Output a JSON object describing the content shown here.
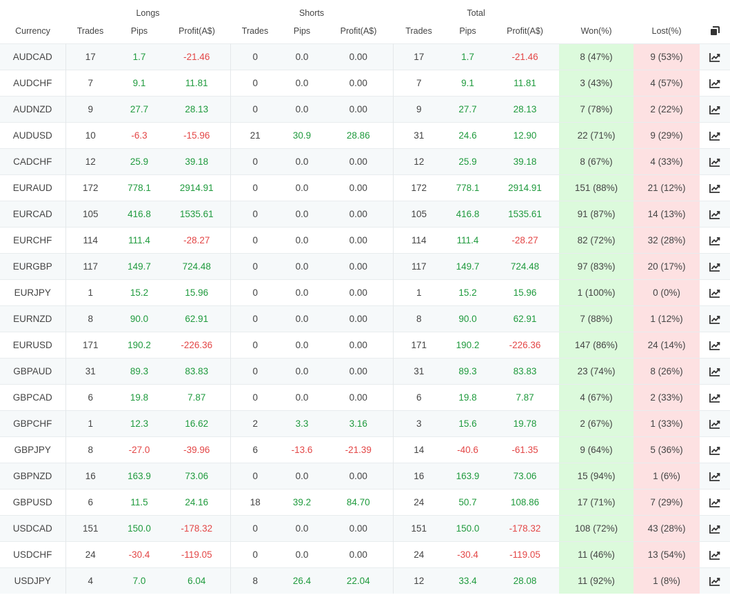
{
  "headers": {
    "longs": "Longs",
    "shorts": "Shorts",
    "total": "Total",
    "currency": "Currency",
    "trades": "Trades",
    "pips": "Pips",
    "profit": "Profit(A$)",
    "won": "Won(%)",
    "lost": "Lost(%)"
  },
  "icons": {
    "copy": "copy-icon",
    "chart": "line-chart-icon"
  },
  "colors": {
    "positive": "#1f9a3d",
    "negative": "#e34646",
    "won_bg": "#dcfadc",
    "lost_bg": "#fde1e2"
  },
  "rows": [
    {
      "currency": "AUDCAD",
      "l_trades": "17",
      "l_pips": "1.7",
      "l_profit": "-21.46",
      "s_trades": "0",
      "s_pips": "0.0",
      "s_profit": "0.00",
      "t_trades": "17",
      "t_pips": "1.7",
      "t_profit": "-21.46",
      "won": "8 (47%)",
      "lost": "9 (53%)"
    },
    {
      "currency": "AUDCHF",
      "l_trades": "7",
      "l_pips": "9.1",
      "l_profit": "11.81",
      "s_trades": "0",
      "s_pips": "0.0",
      "s_profit": "0.00",
      "t_trades": "7",
      "t_pips": "9.1",
      "t_profit": "11.81",
      "won": "3 (43%)",
      "lost": "4 (57%)"
    },
    {
      "currency": "AUDNZD",
      "l_trades": "9",
      "l_pips": "27.7",
      "l_profit": "28.13",
      "s_trades": "0",
      "s_pips": "0.0",
      "s_profit": "0.00",
      "t_trades": "9",
      "t_pips": "27.7",
      "t_profit": "28.13",
      "won": "7 (78%)",
      "lost": "2 (22%)"
    },
    {
      "currency": "AUDUSD",
      "l_trades": "10",
      "l_pips": "-6.3",
      "l_profit": "-15.96",
      "s_trades": "21",
      "s_pips": "30.9",
      "s_profit": "28.86",
      "t_trades": "31",
      "t_pips": "24.6",
      "t_profit": "12.90",
      "won": "22 (71%)",
      "lost": "9 (29%)"
    },
    {
      "currency": "CADCHF",
      "l_trades": "12",
      "l_pips": "25.9",
      "l_profit": "39.18",
      "s_trades": "0",
      "s_pips": "0.0",
      "s_profit": "0.00",
      "t_trades": "12",
      "t_pips": "25.9",
      "t_profit": "39.18",
      "won": "8 (67%)",
      "lost": "4 (33%)"
    },
    {
      "currency": "EURAUD",
      "l_trades": "172",
      "l_pips": "778.1",
      "l_profit": "2914.91",
      "s_trades": "0",
      "s_pips": "0.0",
      "s_profit": "0.00",
      "t_trades": "172",
      "t_pips": "778.1",
      "t_profit": "2914.91",
      "won": "151 (88%)",
      "lost": "21 (12%)"
    },
    {
      "currency": "EURCAD",
      "l_trades": "105",
      "l_pips": "416.8",
      "l_profit": "1535.61",
      "s_trades": "0",
      "s_pips": "0.0",
      "s_profit": "0.00",
      "t_trades": "105",
      "t_pips": "416.8",
      "t_profit": "1535.61",
      "won": "91 (87%)",
      "lost": "14 (13%)"
    },
    {
      "currency": "EURCHF",
      "l_trades": "114",
      "l_pips": "111.4",
      "l_profit": "-28.27",
      "s_trades": "0",
      "s_pips": "0.0",
      "s_profit": "0.00",
      "t_trades": "114",
      "t_pips": "111.4",
      "t_profit": "-28.27",
      "won": "82 (72%)",
      "lost": "32 (28%)"
    },
    {
      "currency": "EURGBP",
      "l_trades": "117",
      "l_pips": "149.7",
      "l_profit": "724.48",
      "s_trades": "0",
      "s_pips": "0.0",
      "s_profit": "0.00",
      "t_trades": "117",
      "t_pips": "149.7",
      "t_profit": "724.48",
      "won": "97 (83%)",
      "lost": "20 (17%)"
    },
    {
      "currency": "EURJPY",
      "l_trades": "1",
      "l_pips": "15.2",
      "l_profit": "15.96",
      "s_trades": "0",
      "s_pips": "0.0",
      "s_profit": "0.00",
      "t_trades": "1",
      "t_pips": "15.2",
      "t_profit": "15.96",
      "won": "1 (100%)",
      "lost": "0 (0%)"
    },
    {
      "currency": "EURNZD",
      "l_trades": "8",
      "l_pips": "90.0",
      "l_profit": "62.91",
      "s_trades": "0",
      "s_pips": "0.0",
      "s_profit": "0.00",
      "t_trades": "8",
      "t_pips": "90.0",
      "t_profit": "62.91",
      "won": "7 (88%)",
      "lost": "1 (12%)"
    },
    {
      "currency": "EURUSD",
      "l_trades": "171",
      "l_pips": "190.2",
      "l_profit": "-226.36",
      "s_trades": "0",
      "s_pips": "0.0",
      "s_profit": "0.00",
      "t_trades": "171",
      "t_pips": "190.2",
      "t_profit": "-226.36",
      "won": "147 (86%)",
      "lost": "24 (14%)"
    },
    {
      "currency": "GBPAUD",
      "l_trades": "31",
      "l_pips": "89.3",
      "l_profit": "83.83",
      "s_trades": "0",
      "s_pips": "0.0",
      "s_profit": "0.00",
      "t_trades": "31",
      "t_pips": "89.3",
      "t_profit": "83.83",
      "won": "23 (74%)",
      "lost": "8 (26%)"
    },
    {
      "currency": "GBPCAD",
      "l_trades": "6",
      "l_pips": "19.8",
      "l_profit": "7.87",
      "s_trades": "0",
      "s_pips": "0.0",
      "s_profit": "0.00",
      "t_trades": "6",
      "t_pips": "19.8",
      "t_profit": "7.87",
      "won": "4 (67%)",
      "lost": "2 (33%)"
    },
    {
      "currency": "GBPCHF",
      "l_trades": "1",
      "l_pips": "12.3",
      "l_profit": "16.62",
      "s_trades": "2",
      "s_pips": "3.3",
      "s_profit": "3.16",
      "t_trades": "3",
      "t_pips": "15.6",
      "t_profit": "19.78",
      "won": "2 (67%)",
      "lost": "1 (33%)"
    },
    {
      "currency": "GBPJPY",
      "l_trades": "8",
      "l_pips": "-27.0",
      "l_profit": "-39.96",
      "s_trades": "6",
      "s_pips": "-13.6",
      "s_profit": "-21.39",
      "t_trades": "14",
      "t_pips": "-40.6",
      "t_profit": "-61.35",
      "won": "9 (64%)",
      "lost": "5 (36%)"
    },
    {
      "currency": "GBPNZD",
      "l_trades": "16",
      "l_pips": "163.9",
      "l_profit": "73.06",
      "s_trades": "0",
      "s_pips": "0.0",
      "s_profit": "0.00",
      "t_trades": "16",
      "t_pips": "163.9",
      "t_profit": "73.06",
      "won": "15 (94%)",
      "lost": "1 (6%)"
    },
    {
      "currency": "GBPUSD",
      "l_trades": "6",
      "l_pips": "11.5",
      "l_profit": "24.16",
      "s_trades": "18",
      "s_pips": "39.2",
      "s_profit": "84.70",
      "t_trades": "24",
      "t_pips": "50.7",
      "t_profit": "108.86",
      "won": "17 (71%)",
      "lost": "7 (29%)"
    },
    {
      "currency": "USDCAD",
      "l_trades": "151",
      "l_pips": "150.0",
      "l_profit": "-178.32",
      "s_trades": "0",
      "s_pips": "0.0",
      "s_profit": "0.00",
      "t_trades": "151",
      "t_pips": "150.0",
      "t_profit": "-178.32",
      "won": "108 (72%)",
      "lost": "43 (28%)"
    },
    {
      "currency": "USDCHF",
      "l_trades": "24",
      "l_pips": "-30.4",
      "l_profit": "-119.05",
      "s_trades": "0",
      "s_pips": "0.0",
      "s_profit": "0.00",
      "t_trades": "24",
      "t_pips": "-30.4",
      "t_profit": "-119.05",
      "won": "11 (46%)",
      "lost": "13 (54%)"
    },
    {
      "currency": "USDJPY",
      "l_trades": "4",
      "l_pips": "7.0",
      "l_profit": "6.04",
      "s_trades": "8",
      "s_pips": "26.4",
      "s_profit": "22.04",
      "t_trades": "12",
      "t_pips": "33.4",
      "t_profit": "28.08",
      "won": "11 (92%)",
      "lost": "1 (8%)"
    }
  ]
}
